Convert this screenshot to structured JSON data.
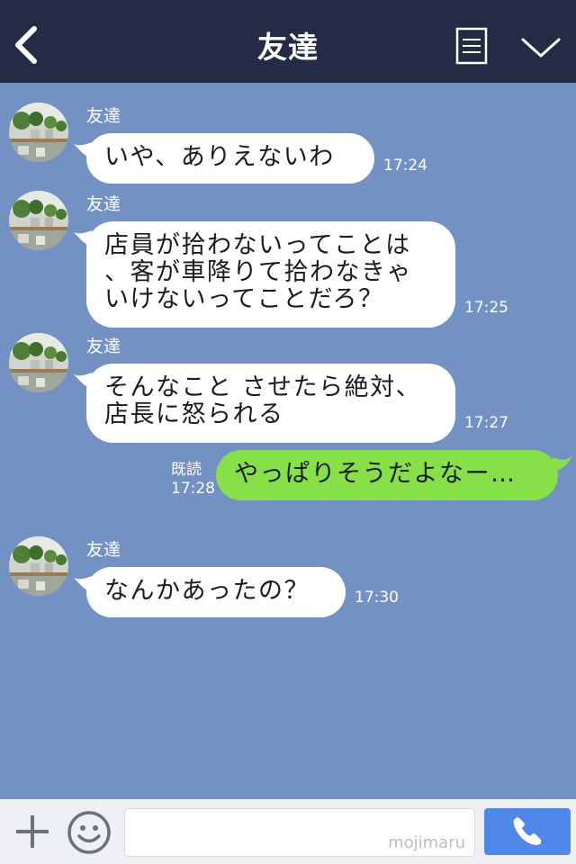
{
  "header": {
    "title": "友達",
    "icons": {
      "back": "chevron-left-icon",
      "menu": "list-icon",
      "more": "chevron-down-icon"
    },
    "bg_color": "#232c44"
  },
  "chat": {
    "bg_color": "#7391c3",
    "messages": [
      {
        "sender": "友達",
        "lines": [
          "いや、ありえないわ"
        ],
        "time": "17:24"
      },
      {
        "sender": "友達",
        "lines": [
          "店員が拾わないってことは",
          "、客が車降りて拾わなきゃ",
          "いけないってことだろ？"
        ],
        "time": "17:25"
      },
      {
        "sender": "友達",
        "lines": [
          "そんなこと させたら絶対、",
          "店長に怒られる"
        ],
        "time": "17:27"
      },
      {
        "sender": "友達",
        "lines": [
          "なんかあったの？"
        ],
        "time": "17:30"
      }
    ],
    "outgoing": {
      "text": "やっぱりそうだよなー…",
      "read_label": "既読",
      "time": "17:28",
      "color": "#87e047"
    }
  },
  "footer": {
    "input_value": "",
    "watermark": "mojimaru",
    "icons": {
      "add": "plus-icon",
      "emoji": "smiley-icon",
      "call": "phone-icon"
    },
    "call_color": "#4f88e8"
  }
}
